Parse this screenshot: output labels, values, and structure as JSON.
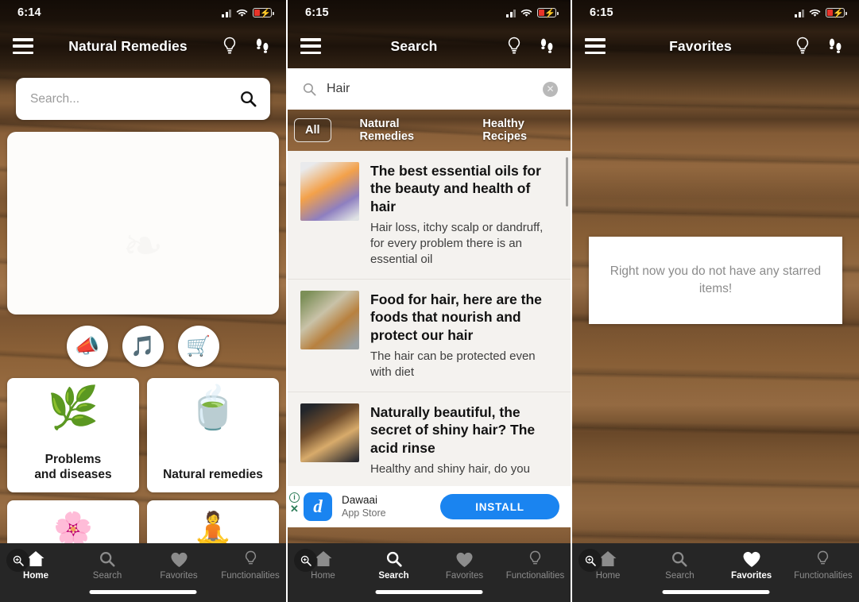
{
  "panels": [
    {
      "id": "home",
      "statusbar": {
        "time": "6:14",
        "signal_icon": "signal-bars-icon",
        "wifi_icon": "wifi-icon",
        "battery_icon": "battery-charging-icon"
      },
      "appbar": {
        "title": "Natural Remedies",
        "menu_icon": "hamburger-menu-icon",
        "bulb_icon": "lightbulb-icon",
        "steps_icon": "footprints-icon"
      },
      "search": {
        "placeholder": "Search...",
        "icon": "search-icon"
      },
      "quick_actions": [
        {
          "name": "megaphone-button",
          "glyph": "📣"
        },
        {
          "name": "music-button",
          "glyph": "🎵"
        },
        {
          "name": "cart-button",
          "glyph": "🛒"
        }
      ],
      "tiles": [
        {
          "label": "Problems\nand diseases",
          "glyph": "🌿"
        },
        {
          "label": "Natural remedies",
          "glyph": "🍵"
        }
      ],
      "tiles_partial": [
        {
          "glyph": "🌸"
        },
        {
          "glyph": "🧘"
        }
      ]
    },
    {
      "id": "search",
      "statusbar": {
        "time": "6:15"
      },
      "appbar": {
        "title": "Search"
      },
      "search": {
        "value": "Hair",
        "icon": "search-icon",
        "clear_label": "✕"
      },
      "segments": [
        {
          "label": "All",
          "active": true
        },
        {
          "label": "Natural Remedies",
          "active": false
        },
        {
          "label": "Healthy Recipes",
          "active": false
        }
      ],
      "results": [
        {
          "title": "The best essential oils for the beauty and health of hair",
          "subtitle": "Hair loss, itchy scalp or dandruff, for every problem there is an essential oil"
        },
        {
          "title": "Food for hair, here are the foods that nourish and protect our hair",
          "subtitle": "The hair can be protected even with diet"
        },
        {
          "title": "Naturally beautiful, the secret of shiny hair? The acid rinse",
          "subtitle": "Healthy and shiny hair, do you"
        }
      ],
      "ad": {
        "name": "Dawaai",
        "source": "App Store",
        "cta": "INSTALL",
        "info_label": "i",
        "close_label": "✕",
        "icon_letter": "d"
      }
    },
    {
      "id": "favorites",
      "statusbar": {
        "time": "6:15"
      },
      "appbar": {
        "title": "Favorites"
      },
      "empty_message": "Right now you do not have any starred items!"
    }
  ],
  "tabbar": {
    "items": [
      {
        "label": "Home",
        "icon": "home-icon"
      },
      {
        "label": "Search",
        "icon": "search-icon"
      },
      {
        "label": "Favorites",
        "icon": "heart-icon"
      },
      {
        "label": "Functionalities",
        "icon": "lightbulb-icon"
      }
    ],
    "active": [
      "Home",
      "Search",
      "Favorites"
    ]
  },
  "colors": {
    "accent_blue": "#1a84f0",
    "tabbar_bg": "#262626",
    "wood_brown": "#8a6138",
    "battery_red": "#e8342a"
  }
}
